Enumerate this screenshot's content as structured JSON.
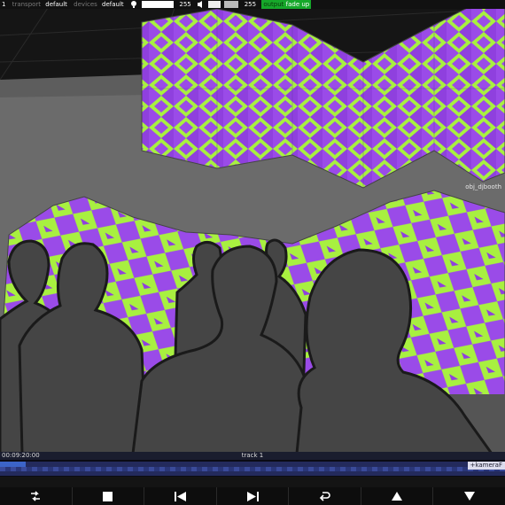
{
  "topbar": {
    "counter": "1",
    "transport_label": "transport",
    "transport_value": "default",
    "devices_label": "devices",
    "devices_value": "default",
    "level_a": "255",
    "level_b": "255",
    "output_label": "output",
    "output_state": "fade up"
  },
  "scene": {
    "object_label": "obj_djbooth",
    "pattern_colors": [
      "#a8f040",
      "#9a4be8"
    ],
    "wall_color": "#6b6b6b",
    "silhouette_color": "#454545"
  },
  "timeline": {
    "timecode": "00:09:20:00",
    "track_name": "track 1",
    "marker_label": "+kameraF",
    "progress": 0.05
  },
  "controls": [
    {
      "name": "loop-icon"
    },
    {
      "name": "stop-icon"
    },
    {
      "name": "skip-back-icon"
    },
    {
      "name": "skip-forward-icon"
    },
    {
      "name": "undo-icon"
    },
    {
      "name": "arrow-up-icon"
    },
    {
      "name": "arrow-down-icon"
    }
  ]
}
